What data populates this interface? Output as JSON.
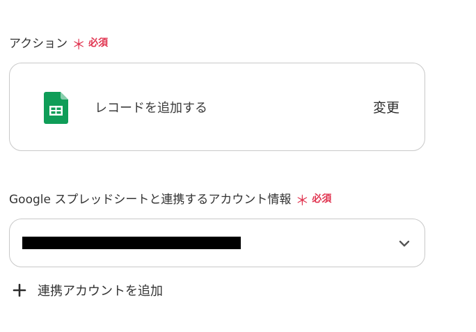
{
  "action_field": {
    "label": "アクション",
    "asterisk": "＊",
    "required": "必須",
    "action_name": "レコードを追加する",
    "change_label": "変更",
    "icon": "google-sheets-icon"
  },
  "account_field": {
    "label": "Google スプレッドシートと連携するアカウント情報",
    "asterisk": "＊",
    "required": "必須",
    "chevron_icon": "chevron-down-icon"
  },
  "add_account": {
    "label": "連携アカウントを追加",
    "icon": "plus-icon"
  },
  "colors": {
    "required": "#e0334f",
    "border": "#c8c8c8",
    "sheets_green": "#0f9d58"
  }
}
